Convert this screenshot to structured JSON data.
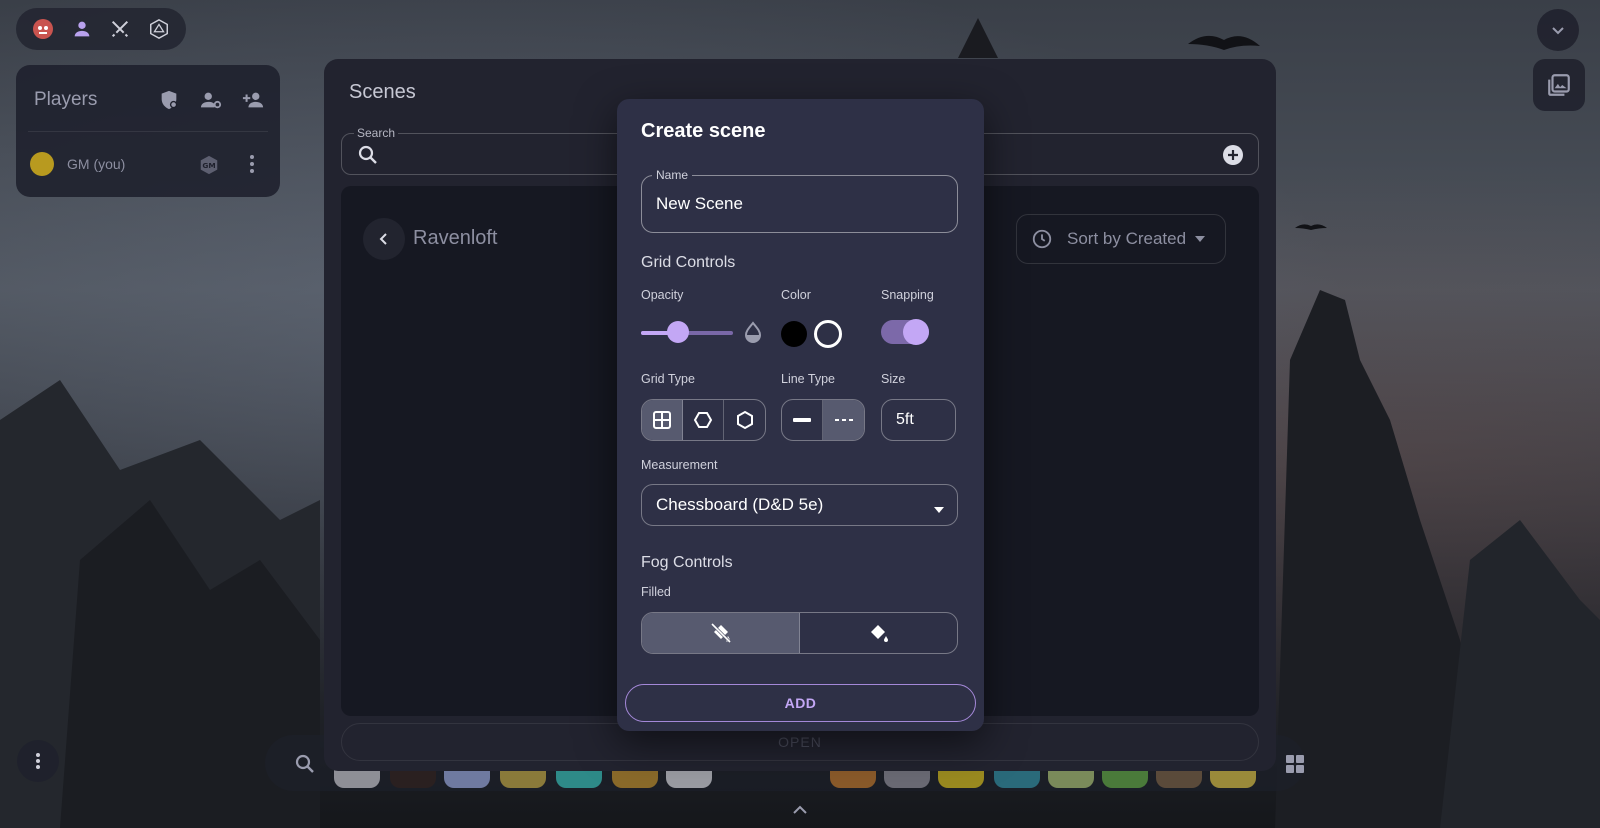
{
  "players_panel": {
    "title": "Players",
    "player_name": "GM (you)",
    "badge_text": "GM"
  },
  "scenes": {
    "title": "Scenes",
    "search_label": "Search",
    "folder_name": "Ravenloft",
    "sort_label": "Sort by Created",
    "open_label": "OPEN"
  },
  "create_scene": {
    "title": "Create scene",
    "name_label": "Name",
    "name_value": "New Scene",
    "grid_controls_title": "Grid Controls",
    "opacity_label": "Opacity",
    "opacity_value": 0.4,
    "color_label": "Color",
    "colors": [
      "#000000",
      "#ffffff"
    ],
    "snapping_label": "Snapping",
    "snapping_on": true,
    "grid_type_label": "Grid Type",
    "grid_types": [
      "square-icon",
      "hex-horizontal-icon",
      "hex-vertical-icon"
    ],
    "line_type_label": "Line Type",
    "line_types": [
      "solid-line-icon",
      "dashed-line-icon"
    ],
    "size_label": "Size",
    "size_value": "5ft",
    "measurement_label": "Measurement",
    "measurement_value": "Chessboard (D&D 5e)",
    "fog_controls_title": "Fog Controls",
    "filled_label": "Filled",
    "add_label": "ADD"
  },
  "theme": {
    "accent": "#c3a7f5",
    "dialog_bg": "#2e3046",
    "panel_bg": "#22232f"
  }
}
